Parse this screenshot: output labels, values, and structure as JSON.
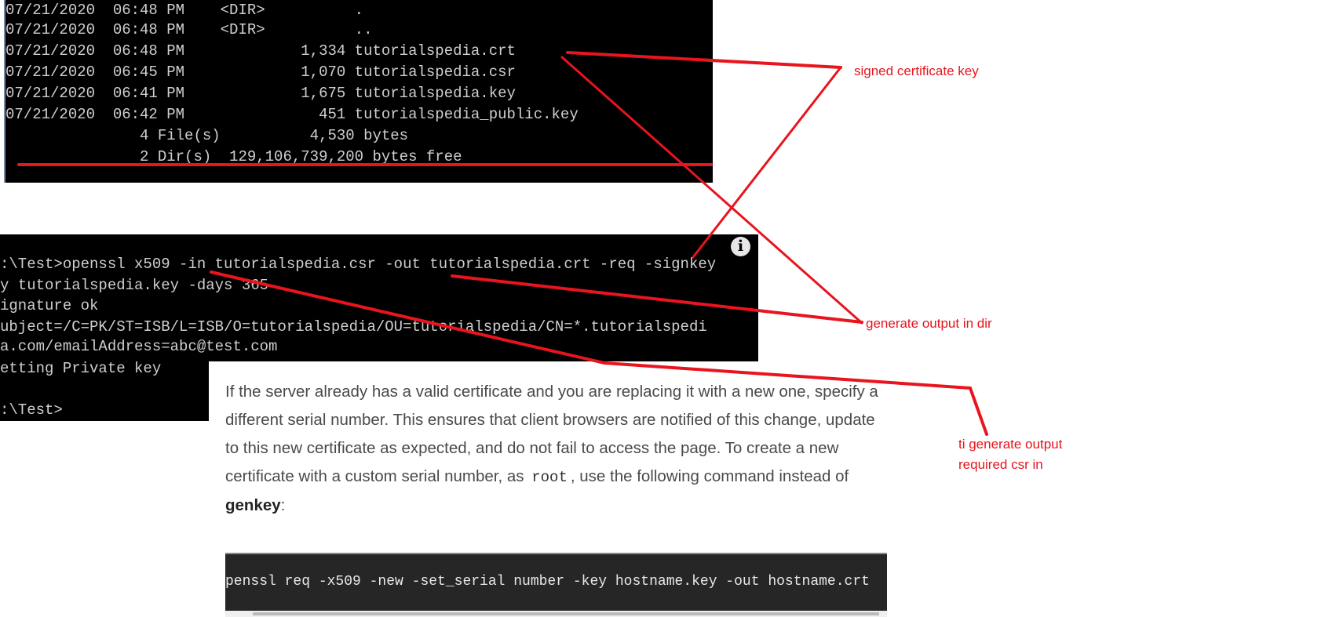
{
  "dir_listing": {
    "rows": [
      "07/21/2020  06:48 PM    <DIR>          .",
      "07/21/2020  06:48 PM    <DIR>          ..",
      "07/21/2020  06:48 PM             1,334 tutorialspedia.crt",
      "07/21/2020  06:45 PM             1,070 tutorialspedia.csr",
      "07/21/2020  06:41 PM             1,675 tutorialspedia.key",
      "07/21/2020  06:42 PM               451 tutorialspedia_public.key",
      "               4 File(s)          4,530 bytes",
      "               2 Dir(s)  129,106,739,200 bytes free"
    ]
  },
  "openssl_terminal": {
    "lines": [
      ":\\Test>openssl x509 -in tutorialspedia.csr -out tutorialspedia.crt -req -signkey",
      "y tutorialspedia.key -days 365",
      "ignature ok",
      "ubject=/C=PK/ST=ISB/L=ISB/O=tutorialspedia/OU=tutorialspedia/CN=*.tutorialspedi",
      "a.com/emailAddress=abc@test.com",
      "etting Private key",
      "",
      ":\\Test>"
    ],
    "info_icon": "i"
  },
  "doc": {
    "para_1": "If the server already has a valid certificate and you are replacing it with a new one, specify a different serial number. This ensures that client browsers are notified of this change, update to this new certificate as expected, and do not fail to access the page. To create a new certificate with a custom serial number, as ",
    "code_inline": "root",
    "para_2": ", use the following command instead of ",
    "bold": "genkey",
    "para_end": ":",
    "code_block": "penssl req -x509 -new -set_serial number -key hostname.key -out hostname.crt"
  },
  "annotations": {
    "signed": "signed certificate key",
    "output_dir": "generate output in dir",
    "csr_line1": "ti generate output",
    "csr_line2": "required csr in",
    "color": "#e8141e"
  }
}
